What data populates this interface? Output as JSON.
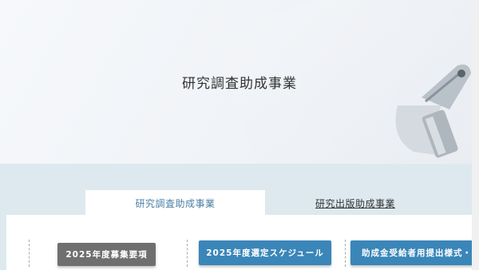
{
  "hero": {
    "title": "研究調査助成事業"
  },
  "tabs": [
    {
      "label": "研究調査助成事業",
      "active": true
    },
    {
      "label": "研究出版助成事業",
      "active": false
    }
  ],
  "buttons": [
    {
      "label": "2025年度募集要項",
      "color": "#6f6f6f"
    },
    {
      "label": "2025年度選定スケジュール",
      "color": "#3a86b9"
    },
    {
      "label": "助成金受給者用提出様式・",
      "color": "#3a86b9"
    }
  ],
  "colors": {
    "accent": "#3a86b9",
    "tab_band": "#dde9ef",
    "active_tab_text": "#4b7fa3"
  }
}
